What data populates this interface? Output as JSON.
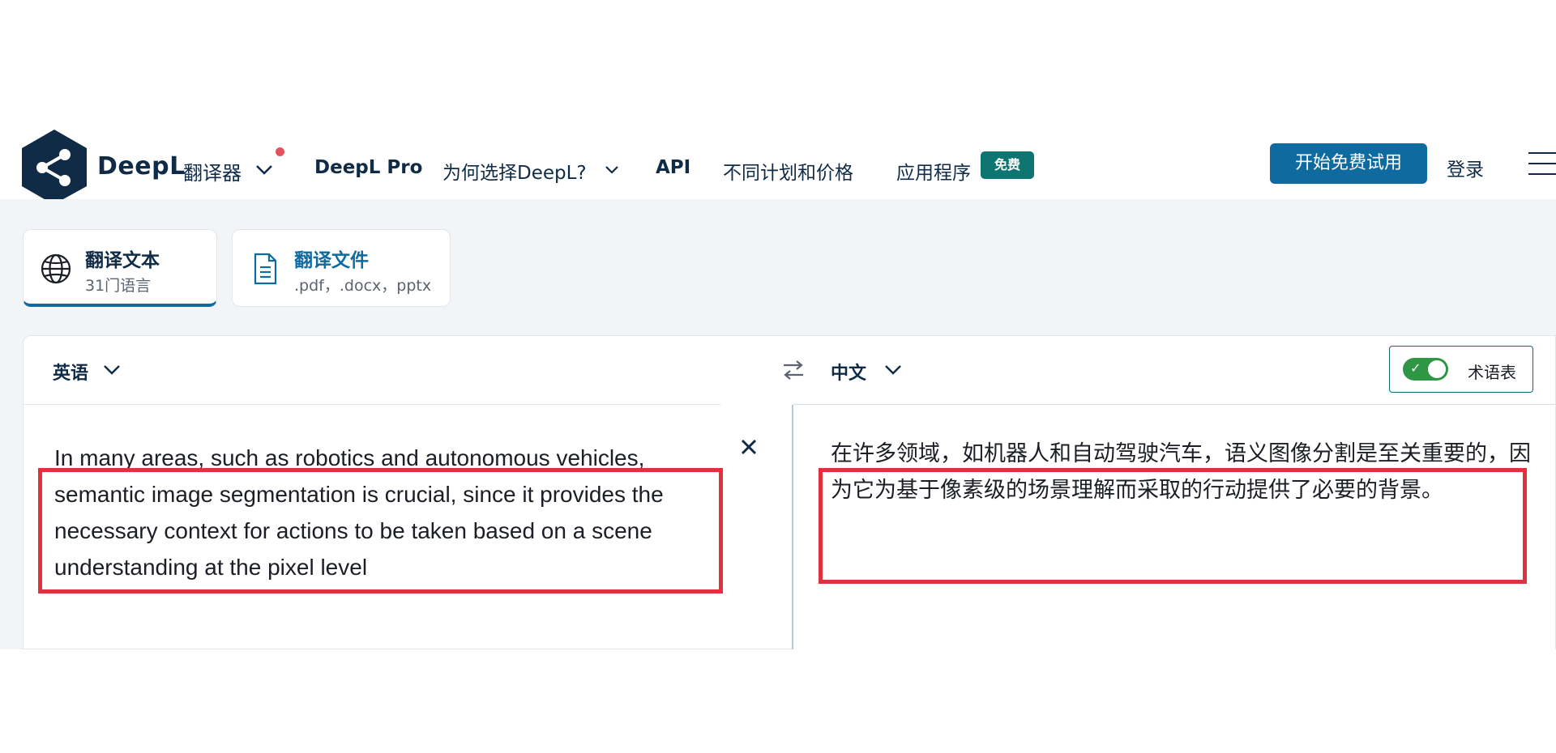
{
  "header": {
    "brand_name": "DeepL",
    "brand_sub": "翻译器",
    "nav": {
      "pro": "DeepL Pro",
      "why": "为何选择DeepL?",
      "api": "API",
      "pricing": "不同计划和价格",
      "apps": "应用程序",
      "free_badge": "免费"
    },
    "trial_button": "开始免费试用",
    "login": "登录"
  },
  "tabs": {
    "text": {
      "title": "翻译文本",
      "sub": "31门语言"
    },
    "file": {
      "title": "翻译文件",
      "sub": ".pdf，.docx，pptx"
    }
  },
  "translator": {
    "source_lang": "英语",
    "target_lang": "中文",
    "glossary_label": "术语表",
    "glossary_enabled": true,
    "source_text": "In many areas, such as robotics and autonomous vehicles, semantic image segmentation is crucial, since it provides the necessary context for actions to be taken based on a scene understanding at the pixel level",
    "target_text": "在许多领域，如机器人和自动驾驶汽车，语义图像分割是至关重要的，因为它为基于像素级的场景理解而采取的行动提供了必要的背景。"
  },
  "colors": {
    "brand_navy": "#0f2b46",
    "primary_button": "#0f6aa0",
    "free_badge": "#0f7570",
    "toggle_on": "#2e9645",
    "annotation_red": "#e0313f"
  }
}
